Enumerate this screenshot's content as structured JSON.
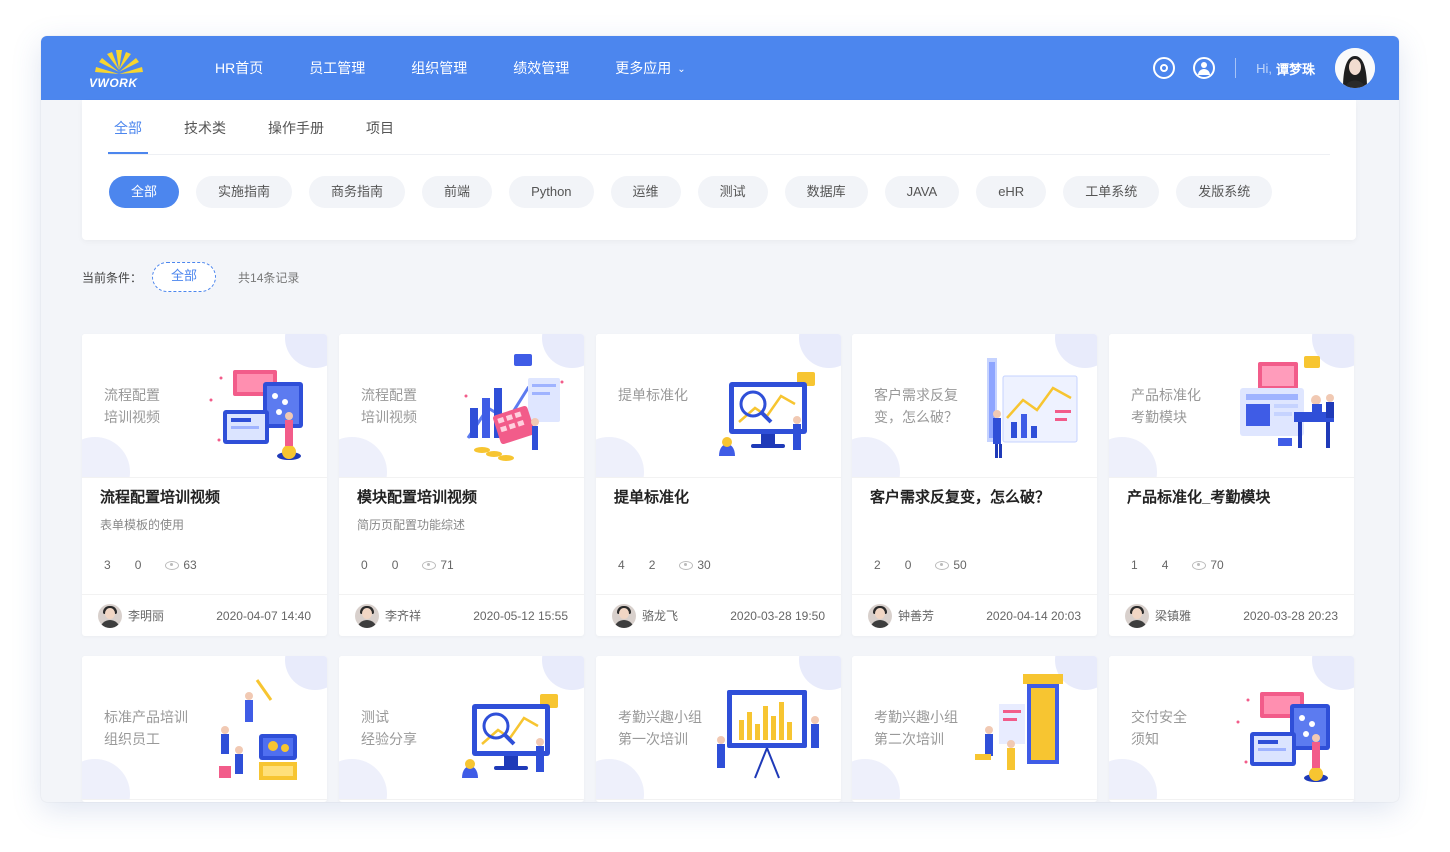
{
  "app": {
    "logo_text": "VWORK"
  },
  "nav": {
    "items": [
      {
        "label": "HR首页"
      },
      {
        "label": "员工管理"
      },
      {
        "label": "组织管理"
      },
      {
        "label": "绩效管理"
      },
      {
        "label": "更多应用"
      }
    ],
    "greeting": "Hi,",
    "username": "谭梦珠"
  },
  "tabs": [
    {
      "label": "全部",
      "active": true
    },
    {
      "label": "技术类"
    },
    {
      "label": "操作手册"
    },
    {
      "label": "项目"
    }
  ],
  "chips": [
    {
      "label": "全部",
      "active": true
    },
    {
      "label": "实施指南"
    },
    {
      "label": "商务指南"
    },
    {
      "label": "前端"
    },
    {
      "label": "Python"
    },
    {
      "label": "运维"
    },
    {
      "label": "测试"
    },
    {
      "label": "数据库"
    },
    {
      "label": "JAVA"
    },
    {
      "label": "eHR"
    },
    {
      "label": "工单系统"
    },
    {
      "label": "发版系统"
    }
  ],
  "conditions": {
    "label": "当前条件：",
    "value": "全部",
    "count": "共14条记录"
  },
  "cards": [
    {
      "banner": [
        "流程配置",
        "培训视频"
      ],
      "title": "流程配置培训视频",
      "subtitle": "表单模板的使用",
      "likes": "3",
      "comments": "0",
      "views": "63",
      "author": "李明丽",
      "date": "2020-04-07 14:40",
      "illus": "dashboard-phone"
    },
    {
      "banner": [
        "流程配置",
        "培训视频"
      ],
      "title": "模块配置培训视频",
      "subtitle": "简历页配置功能综述",
      "likes": "0",
      "comments": "0",
      "views": "71",
      "author": "李齐祥",
      "date": "2020-05-12 15:55",
      "illus": "charts-calculator"
    },
    {
      "banner": [
        "提单标准化"
      ],
      "title": "提单标准化",
      "subtitle": "",
      "likes": "4",
      "comments": "2",
      "views": "30",
      "author": "骆龙飞",
      "date": "2020-03-28 19:50",
      "illus": "monitor-search"
    },
    {
      "banner": [
        "客户需求反复",
        "变，怎么破？"
      ],
      "title": "客户需求反复变，怎么破？",
      "subtitle": "",
      "likes": "2",
      "comments": "0",
      "views": "50",
      "author": "钟善芳",
      "date": "2020-04-14 20:03",
      "illus": "chart-board"
    },
    {
      "banner": [
        "产品标准化",
        "考勤模块"
      ],
      "title": "产品标准化_考勤模块",
      "subtitle": "",
      "likes": "1",
      "comments": "4",
      "views": "70",
      "author": "梁镇雅",
      "date": "2020-03-28 20:23",
      "illus": "workspace"
    },
    {
      "banner": [
        "标准产品培训",
        "组织员工"
      ],
      "title": "",
      "subtitle": "",
      "illus": "team-gear"
    },
    {
      "banner": [
        "测试",
        "经验分享"
      ],
      "title": "",
      "subtitle": "",
      "illus": "monitor-search"
    },
    {
      "banner": [
        "考勤兴趣小组",
        "第一次培训"
      ],
      "title": "",
      "subtitle": "",
      "illus": "presentation"
    },
    {
      "banner": [
        "考勤兴趣小组",
        "第二次培训"
      ],
      "title": "",
      "subtitle": "",
      "illus": "door"
    },
    {
      "banner": [
        "交付安全",
        "须知"
      ],
      "title": "",
      "subtitle": "",
      "illus": "dashboard-phone"
    }
  ],
  "colors": {
    "primary": "#4c86ee",
    "background": "#f3f5f9"
  }
}
